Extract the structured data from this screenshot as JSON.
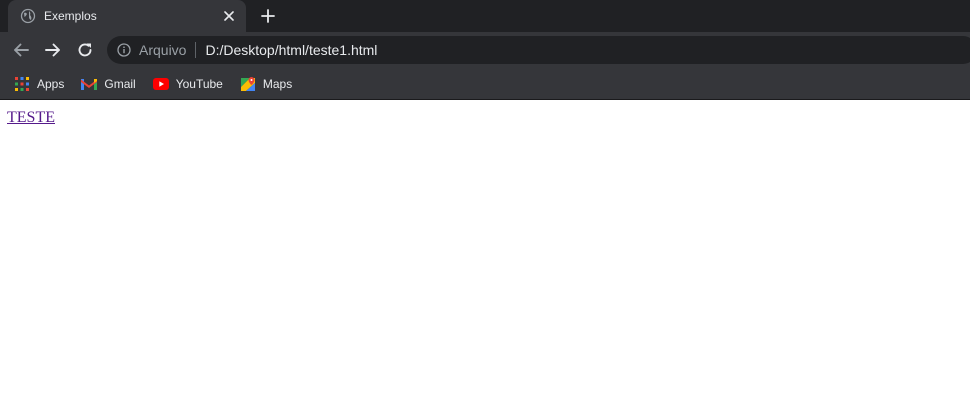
{
  "tab": {
    "title": "Exemplos",
    "favicon": "globe-icon"
  },
  "toolbar": {
    "back_icon": "arrow-left-icon",
    "forward_icon": "arrow-right-icon",
    "reload_icon": "reload-icon"
  },
  "omnibox": {
    "site_label": "Arquivo",
    "url": "D:/Desktop/html/teste1.html"
  },
  "bookmarks": [
    {
      "label": "Apps",
      "icon": "apps-grid-icon"
    },
    {
      "label": "Gmail",
      "icon": "gmail-icon"
    },
    {
      "label": "YouTube",
      "icon": "youtube-icon"
    },
    {
      "label": "Maps",
      "icon": "maps-icon"
    }
  ],
  "page": {
    "link_text": "TESTE"
  },
  "colors": {
    "tabstrip": "#202124",
    "toolbar": "#35363a",
    "visited_link": "#551a8b"
  }
}
